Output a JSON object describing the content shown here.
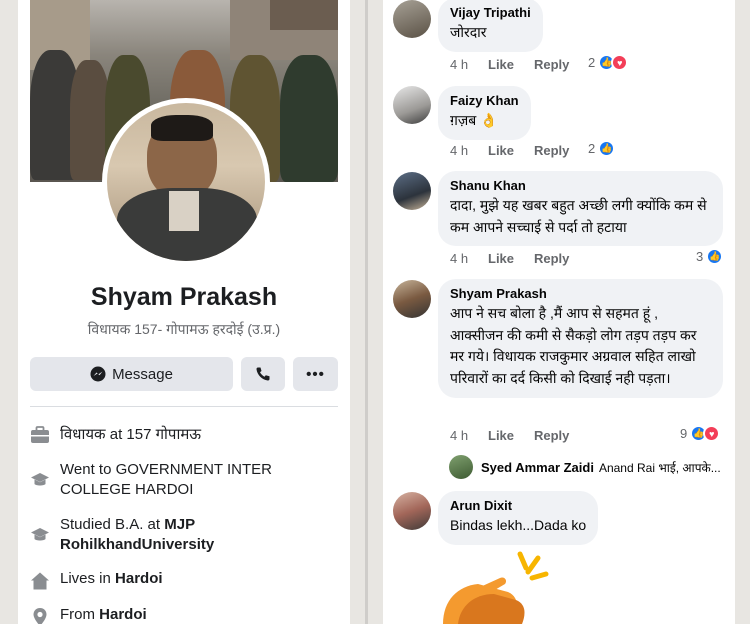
{
  "profile": {
    "name": "Shyam Prakash",
    "subtitle": "विधायक 157- गोपामऊ हरदोई (उ.प्र.)",
    "message_label": "Message",
    "details": [
      {
        "icon": "briefcase-icon",
        "prefix": "विधायक at 157 गोपामऊ",
        "strong": ""
      },
      {
        "icon": "graduation-cap-icon",
        "prefix": "Went to GOVERNMENT INTER COLLEGE HARDOI",
        "strong": ""
      },
      {
        "icon": "graduation-cap-icon",
        "prefix": "Studied B.A. at ",
        "strong": "MJP RohilkhandUniversity"
      },
      {
        "icon": "home-icon",
        "prefix": "Lives in ",
        "strong": "Hardoi"
      },
      {
        "icon": "location-pin-icon",
        "prefix": "From ",
        "strong": "Hardoi"
      }
    ]
  },
  "comments": [
    {
      "author": "Vijay Tripathi",
      "text": "जोरदार",
      "time": "4 h",
      "like": "Like",
      "reply": "Reply",
      "reactions": "2"
    },
    {
      "author": "Faizy Khan",
      "text": "ग़ज़ब 👌",
      "time": "4 h",
      "like": "Like",
      "reply": "Reply",
      "reactions": "2"
    },
    {
      "author": "Shanu Khan",
      "text": "दादा, मुझे यह खबर बहुत अच्छी लगी क्योंकि कम से कम आपने सच्चाई से पर्दा तो हटाया",
      "time": "4 h",
      "like": "Like",
      "reply": "Reply",
      "reactions": "3"
    },
    {
      "author": "Shyam Prakash",
      "text": "आप ने सच बोला है ,मैं आप से सहमत हूं , आक्सीजन की कमी से सैकड़ो लोग तड़प तड़प कर मर गये। विधायक राजकुमार अग्रवाल सहित लाखो परिवारों का दर्द किसी को दिखाई नही पड़ता।",
      "time": "4 h",
      "like": "Like",
      "reply": "Reply",
      "reactions": "9"
    },
    {
      "author": "Arun Dixit",
      "text": "Bindas lekh...Dada ko",
      "time": "",
      "like": "",
      "reply": "",
      "reactions": ""
    }
  ],
  "reply_preview": {
    "author": "Syed Ammar Zaidi",
    "text": "Anand Rai भाई, आपके..."
  }
}
